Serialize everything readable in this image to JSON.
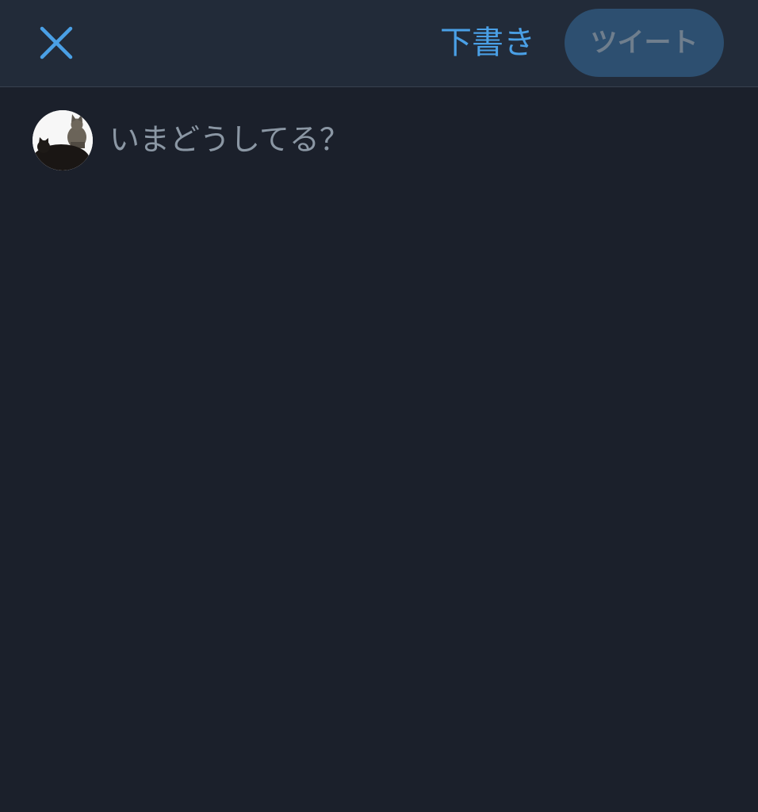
{
  "header": {
    "close_icon": "close-icon",
    "drafts_label": "下書き",
    "tweet_label": "ツイート"
  },
  "composer": {
    "avatar_icon": "user-avatar-cat",
    "placeholder": "いまどうしてる？",
    "value": ""
  },
  "colors": {
    "background": "#1b202b",
    "header_background": "#222b39",
    "accent": "#4aa0e6",
    "tweet_button_disabled": "#2d4f70",
    "placeholder": "#8b97a4"
  }
}
